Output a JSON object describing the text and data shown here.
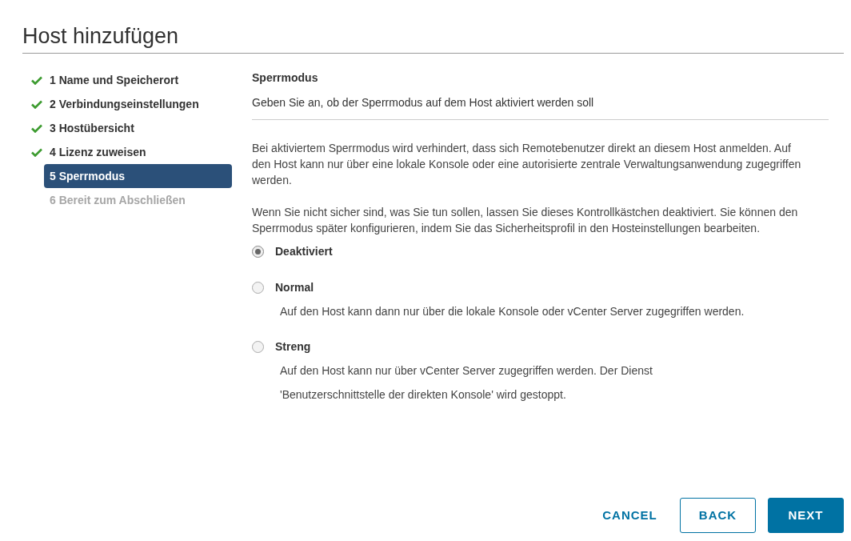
{
  "dialog": {
    "title": "Host hinzufügen"
  },
  "steps": [
    {
      "label": "1 Name und Speicherort",
      "completed": true,
      "selected": false
    },
    {
      "label": "2 Verbindungseinstellungen",
      "completed": true,
      "selected": false
    },
    {
      "label": "3 Hostübersicht",
      "completed": true,
      "selected": false
    },
    {
      "label": "4 Lizenz zuweisen",
      "completed": true,
      "selected": false
    },
    {
      "label": "5 Sperrmodus",
      "completed": false,
      "selected": true
    },
    {
      "label": "6 Bereit zum Abschließen",
      "completed": false,
      "selected": false
    }
  ],
  "section": {
    "heading": "Sperrmodus",
    "subtitle": "Geben Sie an, ob der Sperrmodus auf dem Host aktiviert werden soll"
  },
  "paragraphs": [
    "Bei aktiviertem Sperrmodus wird verhindert, dass sich Remotebenutzer direkt an diesem Host anmelden. Auf den Host kann nur über eine lokale Konsole oder eine autorisierte zentrale Verwaltungsanwendung zugegriffen werden.",
    "Wenn Sie nicht sicher sind, was Sie tun sollen, lassen Sie dieses Kontrollkästchen deaktiviert. Sie können den Sperrmodus später konfigurieren, indem Sie das Sicherheitsprofil in den Hosteinstellungen bearbeiten."
  ],
  "options": [
    {
      "label": "Deaktiviert",
      "selected": true
    },
    {
      "label": "Normal",
      "selected": false,
      "description": [
        "Auf den Host kann dann nur über die lokale Konsole oder vCenter Server zugegriffen werden."
      ]
    },
    {
      "label": "Streng",
      "selected": false,
      "description": [
        "Auf den Host kann nur über vCenter Server zugegriffen werden. Der Dienst",
        "'Benutzerschnittstelle der direkten Konsole' wird gestoppt."
      ]
    }
  ],
  "buttons": [
    {
      "label": "CANCEL",
      "kind": "flat"
    },
    {
      "label": "BACK",
      "kind": "outline"
    },
    {
      "label": "NEXT",
      "kind": "primary"
    }
  ]
}
